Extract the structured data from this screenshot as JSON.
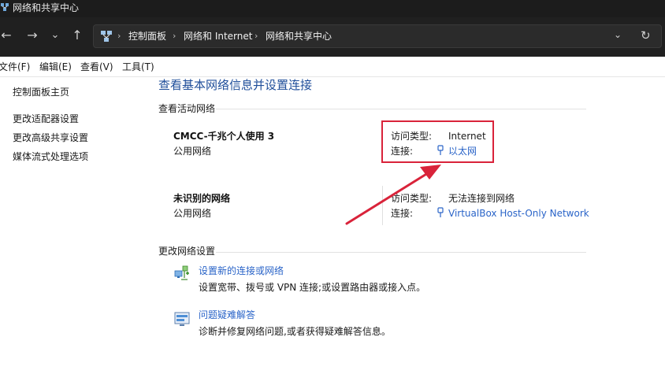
{
  "window": {
    "title": "网络和共享中心"
  },
  "nav": {
    "back": "←",
    "forward": "→",
    "recent": "⌄",
    "up": "↑",
    "breadcrumbs": [
      "控制面板",
      "网络和 Internet",
      "网络和共享中心"
    ],
    "crumb_sep": "›",
    "dropdown": "⌄",
    "refresh": "↻"
  },
  "menu": {
    "items": [
      "文件(F)",
      "编辑(E)",
      "查看(V)",
      "工具(T)"
    ]
  },
  "sidebar": {
    "items": [
      "控制面板主页",
      "更改适配器设置",
      "更改高级共享设置",
      "媒体流式处理选项"
    ]
  },
  "main": {
    "title": "查看基本网络信息并设置连接",
    "active_networks_heading": "查看活动网络",
    "networks": [
      {
        "name": "CMCC-千兆个人使用 3",
        "type": "公用网络",
        "access_label": "访问类型:",
        "access_value": "Internet",
        "conn_label": "连接:",
        "conn_value": "以太网"
      },
      {
        "name": "未识别的网络",
        "type": "公用网络",
        "access_label": "访问类型:",
        "access_value": "无法连接到网络",
        "conn_label": "连接:",
        "conn_value": "VirtualBox Host-Only Network"
      }
    ],
    "change_settings_heading": "更改网络设置",
    "tasks": [
      {
        "link": "设置新的连接或网络",
        "desc": "设置宽带、拨号或 VPN 连接;或设置路由器或接入点。",
        "icon": "new-connection-icon"
      },
      {
        "link": "问题疑难解答",
        "desc": "诊断并修复网络问题,或者获得疑难解答信息。",
        "icon": "troubleshoot-icon"
      }
    ]
  },
  "colors": {
    "titlebar_bg": "#1c1c1c",
    "navbar_bg": "#202020",
    "link": "#2a64c8",
    "title_blue": "#1f4e9a",
    "annotation_red": "#d9233a"
  }
}
